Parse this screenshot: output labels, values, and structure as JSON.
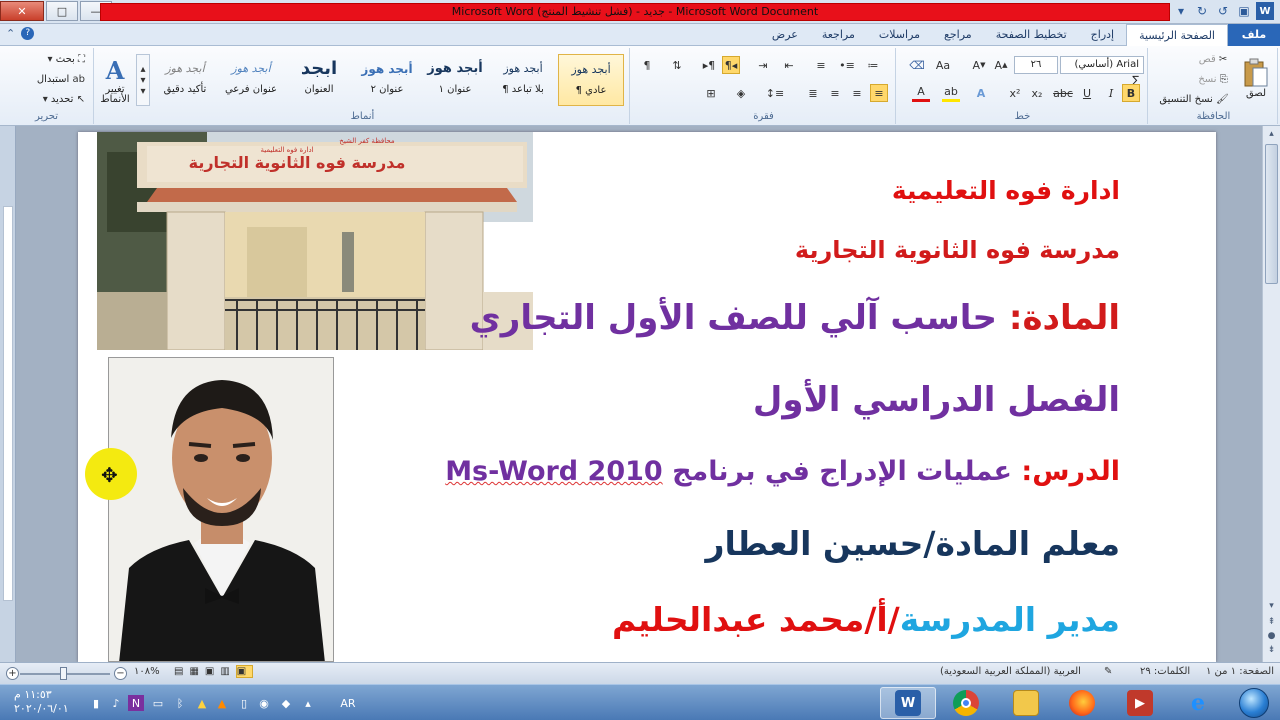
{
  "window": {
    "title": "Microsoft Word جديد - (فشل تنشيط المنتج) - Microsoft Word Document",
    "qat": [
      "✕",
      "□",
      "—"
    ]
  },
  "ribbon_tabs": {
    "file": "ملف",
    "tabs": [
      "الصفحة الرئيسية",
      "إدراج",
      "تخطيط الصفحة",
      "مراجع",
      "مراسلات",
      "مراجعة",
      "عرض"
    ]
  },
  "clipboard": {
    "paste": "لصق",
    "cut": "قص",
    "copy": "نسخ",
    "format_painter": "نسخ التنسيق",
    "group": "الحافظة"
  },
  "font": {
    "name": "Arial (أساسي) ∑",
    "size": "٢٦",
    "group": "خط"
  },
  "paragraph": {
    "group": "فقرة"
  },
  "styles": {
    "group": "أنماط",
    "items": [
      {
        "sample": "أبجد هوز",
        "name": "¶ عادي"
      },
      {
        "sample": "أبجد هوز",
        "name": "¶ بلا تباعد"
      },
      {
        "sample": "أبجد هوز",
        "name": "عنوان ١"
      },
      {
        "sample": "أبجد هوز",
        "name": "عنوان ٢"
      },
      {
        "sample": "ابجد",
        "name": "العنوان"
      },
      {
        "sample": "أبجد هوز",
        "name": "عنوان فرعي"
      },
      {
        "sample": "أبجد هوز",
        "name": "تأكيد دقيق"
      }
    ],
    "change_styles": "تغيير الأنماط"
  },
  "editing": {
    "group": "تحرير",
    "find": "بحث",
    "replace": "استبدال",
    "select": "تحديد"
  },
  "document": {
    "line1": "ادارة فوه التعليمية",
    "line2": "مدرسة فوه الثانوية التجارية",
    "line3_pre": "المادة:",
    "line3_rest": " حاسب آلي للصف الأول التجاري",
    "line4": "الفصل الدراسي الأول",
    "line5_pre": "الدرس:",
    "line5_rest": " عمليات الإدراج في برنامج ",
    "line5_latin": "Ms-Word 2010",
    "line6": "معلم المادة/حسين العطار",
    "line7_a": "مدير المدرسة",
    "line7_b": "/أ/محمد عبدالحليم",
    "sign_top": "محافظة كفر الشيخ",
    "sign_sub": "ادارة فوه التعليمية",
    "sign_main": "مدرسة فوه الثانوية التجارية"
  },
  "status": {
    "page": "الصفحة: ١ من ١",
    "words": "الكلمات: ٢٩",
    "language": "العربية (المملكة العربية السعودية)",
    "zoom": "١٠٨%"
  },
  "taskbar": {
    "time": "١١:٥٣ م",
    "date": "٢٠٢٠/٠٦/٠١",
    "lang": "AR"
  }
}
